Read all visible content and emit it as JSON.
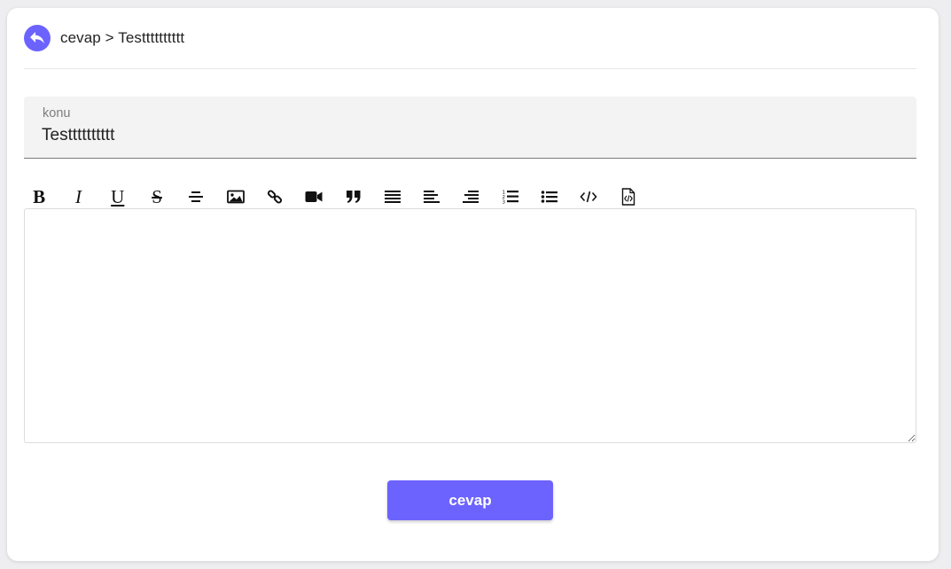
{
  "header": {
    "back_icon": "reply-arrow-icon",
    "breadcrumb": "cevap > Testttttttttt"
  },
  "subject_field": {
    "label": "konu",
    "value": "Testttttttttt"
  },
  "toolbar": {
    "bold": "B",
    "italic": "I",
    "underline": "U",
    "strike": "S",
    "icons": [
      "bold-icon",
      "italic-icon",
      "underline-icon",
      "strikethrough-icon",
      "horizontal-rule-icon",
      "image-icon",
      "link-icon",
      "video-icon",
      "blockquote-icon",
      "align-justify-icon",
      "align-left-icon",
      "align-right-icon",
      "ordered-list-icon",
      "unordered-list-icon",
      "code-icon",
      "source-file-icon"
    ]
  },
  "editor": {
    "content": ""
  },
  "submit": {
    "label": "cevap"
  },
  "colors": {
    "accent": "#6c63ff",
    "background": "#eeeef0",
    "card": "#ffffff",
    "field_bg": "#f3f3f4"
  }
}
